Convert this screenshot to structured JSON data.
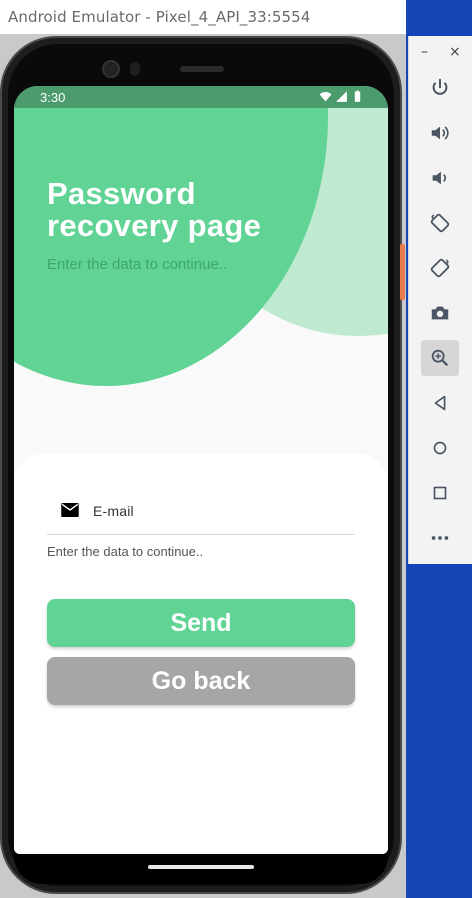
{
  "window": {
    "title": "Android Emulator - Pixel_4_API_33:5554"
  },
  "toolbar": {
    "minimize": "–",
    "close": "×",
    "buttons": [
      {
        "icon": "power-icon"
      },
      {
        "icon": "volume-up-icon"
      },
      {
        "icon": "volume-down-icon"
      },
      {
        "icon": "rotate-left-icon"
      },
      {
        "icon": "rotate-right-icon"
      },
      {
        "icon": "camera-icon"
      },
      {
        "icon": "zoom-icon"
      },
      {
        "icon": "back-icon"
      },
      {
        "icon": "home-icon"
      },
      {
        "icon": "overview-icon"
      },
      {
        "icon": "more-icon"
      }
    ]
  },
  "status_bar": {
    "time": "3:30"
  },
  "app": {
    "title_line1": "Password",
    "title_line2": "recovery page",
    "subtitle": "Enter the data to continue..",
    "email_label": "E-mail",
    "hint": "Enter the data to continue..",
    "send_label": "Send",
    "back_label": "Go back"
  },
  "colors": {
    "primary": "#61d395",
    "primary_light": "#bfe9d1",
    "status_bar": "#4b9b6d",
    "button_secondary": "#a6a6a6",
    "desktop": "#1447b5"
  }
}
